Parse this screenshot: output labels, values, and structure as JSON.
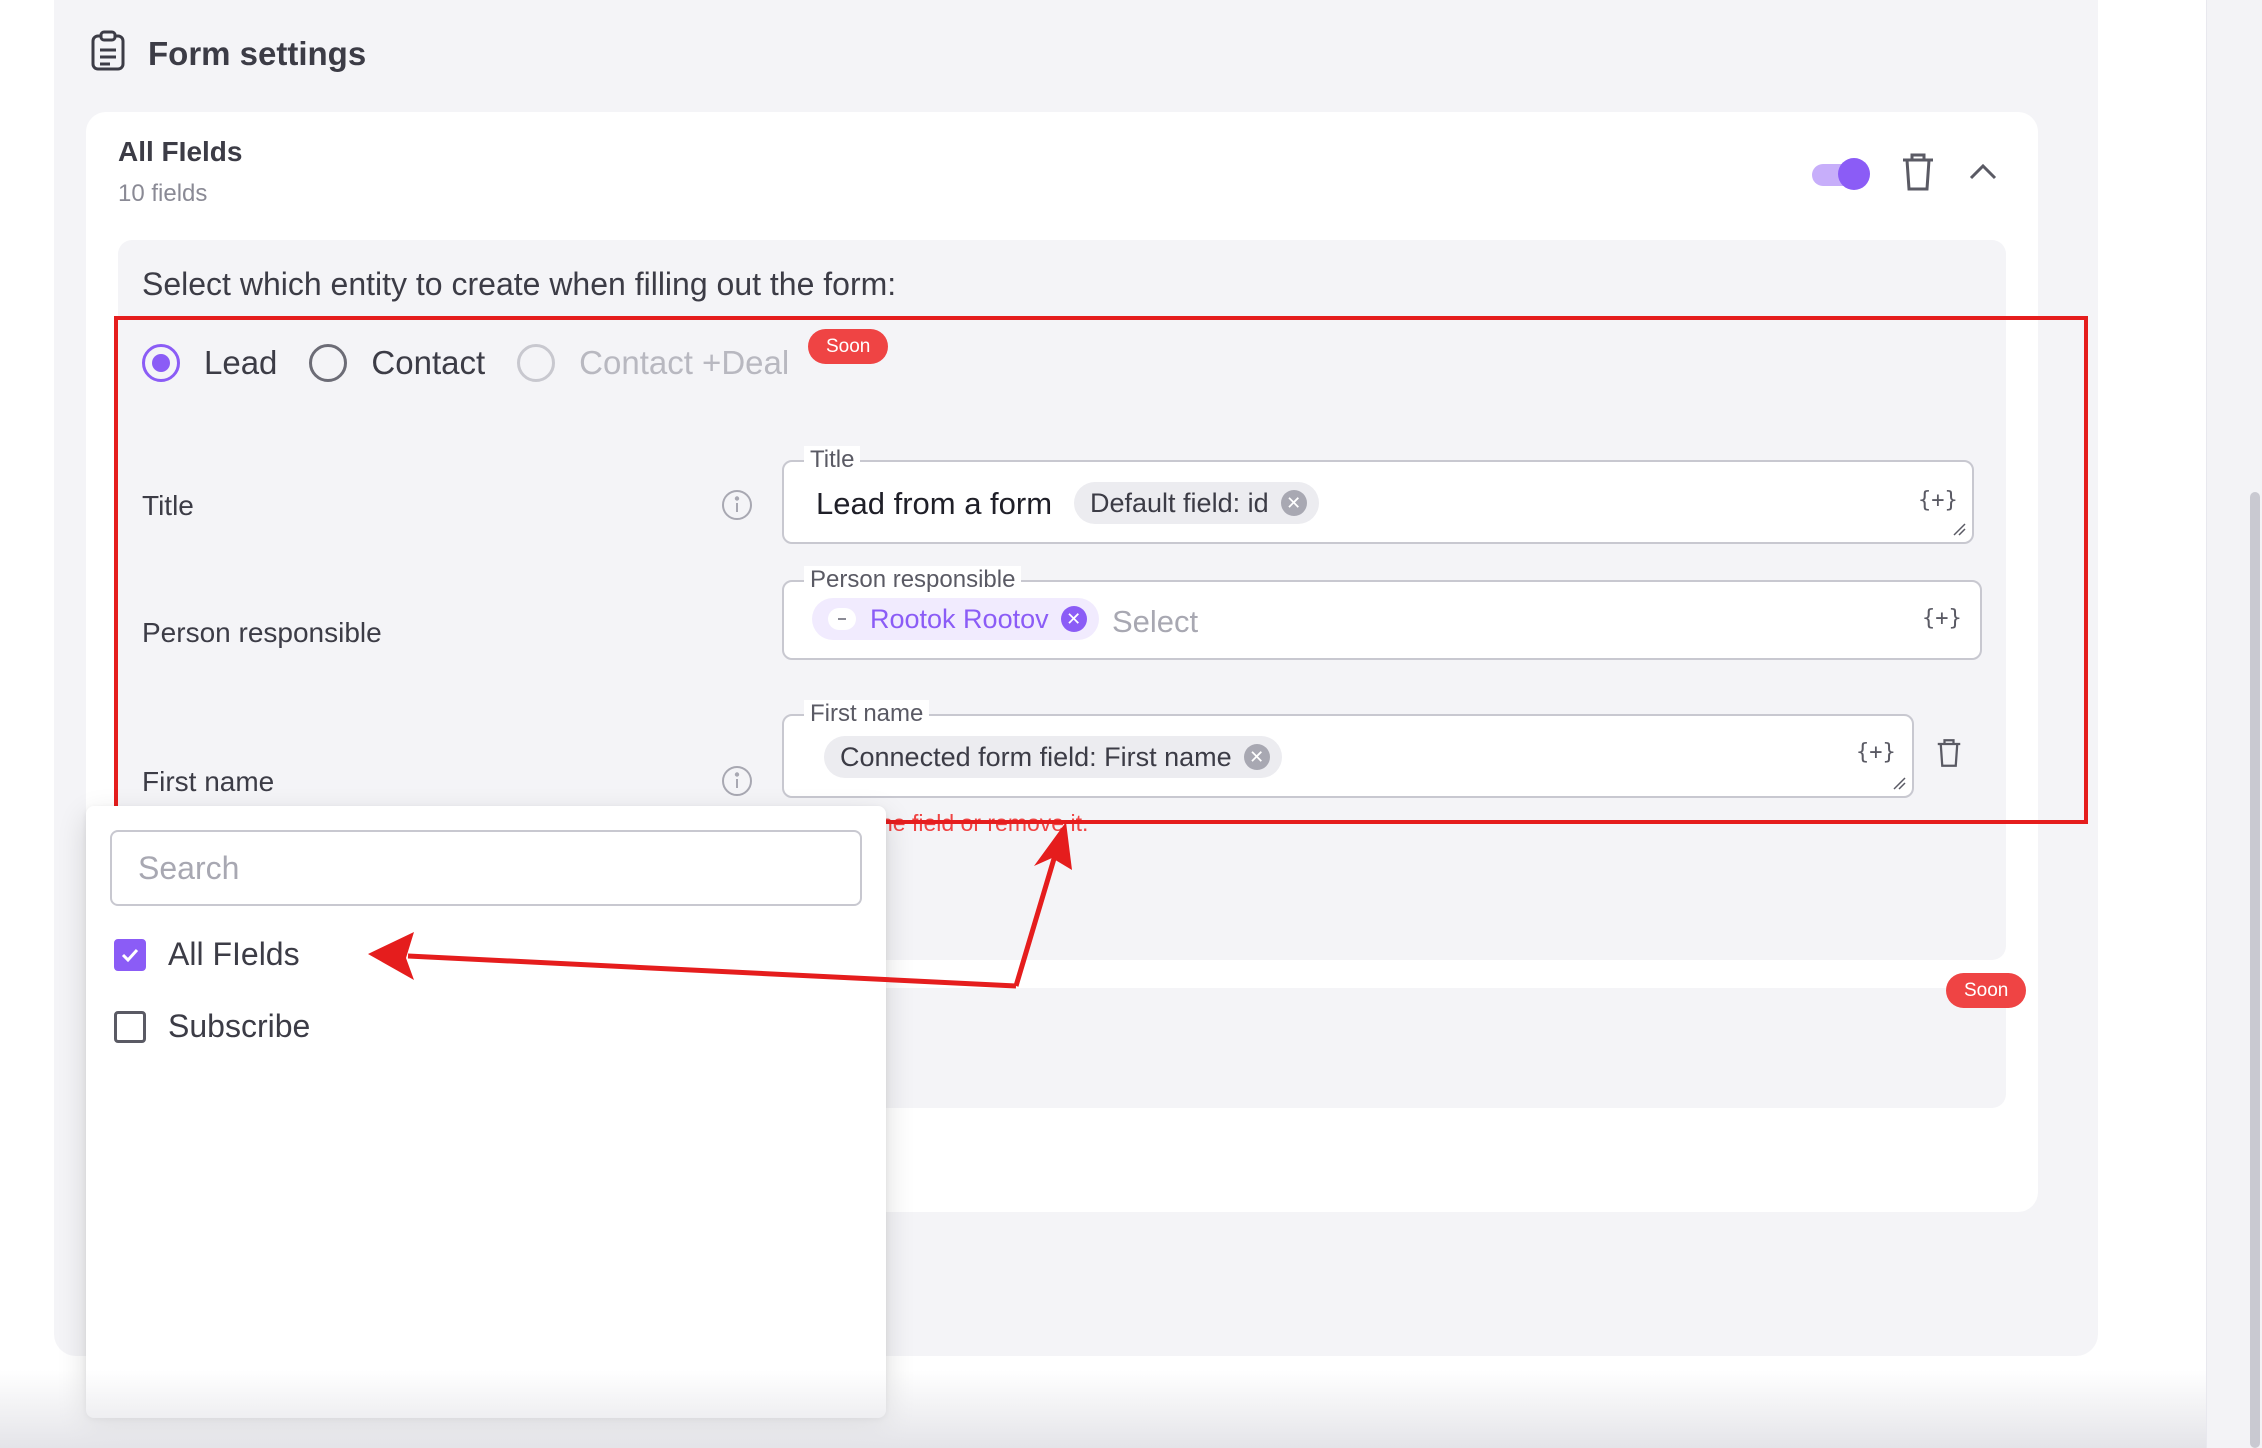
{
  "header": {
    "title": "Form settings",
    "icon": "clipboard-icon"
  },
  "section": {
    "title": "All FIelds",
    "subtitle": "10 fields",
    "toggle_on": true,
    "accent_color": "#8b5cf6"
  },
  "entity": {
    "prompt": "Select which entity to create when filling out the form:",
    "options": [
      {
        "label": "Lead",
        "selected": true,
        "disabled": false
      },
      {
        "label": "Contact",
        "selected": false,
        "disabled": false
      },
      {
        "label": "Contact +Deal",
        "selected": false,
        "disabled": true
      }
    ],
    "soon_badge": "Soon"
  },
  "fields": {
    "title": {
      "row_label": "Title",
      "legend": "Title",
      "value_text": "Lead from a form",
      "chip": "Default field: id",
      "var_button": "{+}"
    },
    "person": {
      "row_label": "Person responsible",
      "legend": "Person responsible",
      "chip": "Rootok Rootov",
      "placeholder": "Select",
      "var_button": "{+}"
    },
    "first_name": {
      "row_label": "First name",
      "legend": "First name",
      "chip": "Connected form field: First name",
      "var_button": "{+}",
      "error": "ne field or remove it."
    }
  },
  "second_panel": {
    "soon_badge": "Soon"
  },
  "dropdown": {
    "search_placeholder": "Search",
    "items": [
      {
        "label": "All FIelds",
        "checked": true
      },
      {
        "label": "Subscribe",
        "checked": false
      }
    ]
  },
  "annotation": {
    "color": "#e51d1d"
  }
}
